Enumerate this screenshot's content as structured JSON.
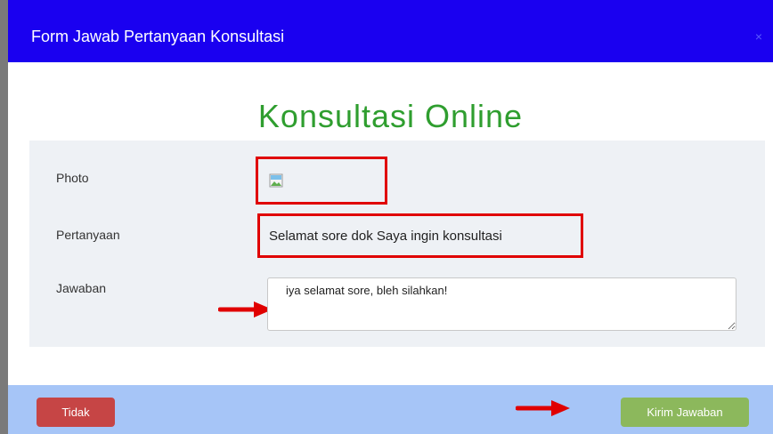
{
  "modal": {
    "title": "Form Jawab Pertanyaan Konsultasi",
    "close_glyph": "×"
  },
  "form": {
    "heading": "Konsultasi Online",
    "photo_label": "Photo",
    "question_label": "Pertanyaan",
    "question_text": "Selamat sore dok Saya ingin konsultasi",
    "answer_label": "Jawaban",
    "answer_value": "iya selamat sore, bleh silahkan!"
  },
  "footer": {
    "cancel_label": "Tidak",
    "submit_label": "Kirim Jawaban"
  },
  "colors": {
    "header_bg": "#1a00f0",
    "heading_green": "#2f9e2f",
    "highlight_red": "#e00000",
    "footer_bg": "#a6c5f7",
    "cancel_red": "#c64545",
    "submit_green": "#8cb85c"
  },
  "icons": {
    "close": "close-icon",
    "photo": "broken-image-icon",
    "annotation": "red-arrow-icon"
  }
}
